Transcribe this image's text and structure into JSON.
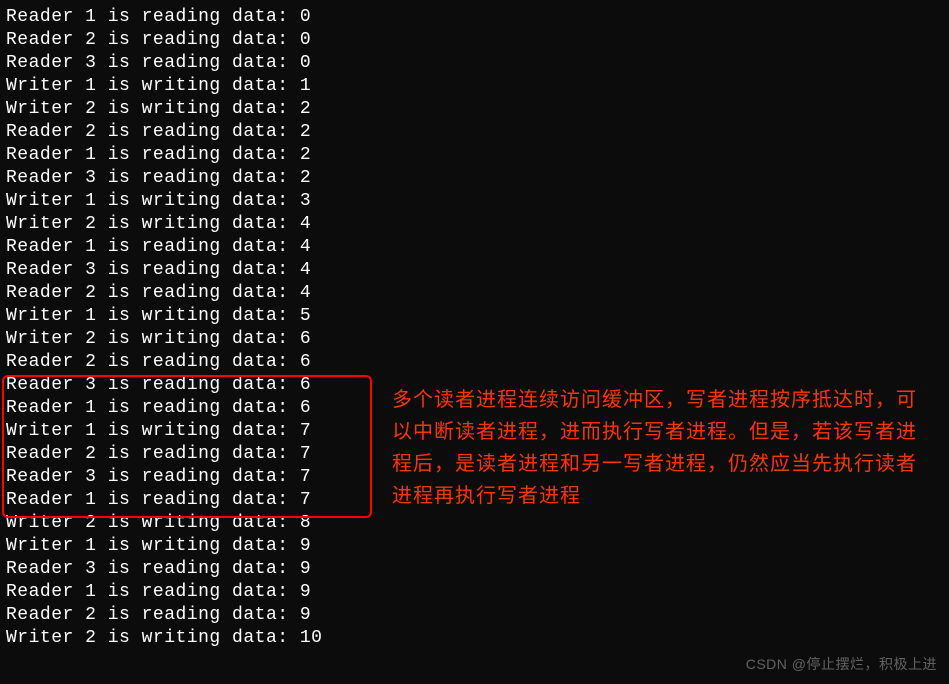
{
  "terminal": {
    "lines": [
      "Reader 1 is reading data: 0",
      "Reader 2 is reading data: 0",
      "Reader 3 is reading data: 0",
      "Writer 1 is writing data: 1",
      "Writer 2 is writing data: 2",
      "Reader 2 is reading data: 2",
      "Reader 1 is reading data: 2",
      "Reader 3 is reading data: 2",
      "Writer 1 is writing data: 3",
      "Writer 2 is writing data: 4",
      "Reader 1 is reading data: 4",
      "Reader 3 is reading data: 4",
      "Reader 2 is reading data: 4",
      "Writer 1 is writing data: 5",
      "Writer 2 is writing data: 6",
      "Reader 2 is reading data: 6",
      "Reader 3 is reading data: 6",
      "Reader 1 is reading data: 6",
      "Writer 1 is writing data: 7",
      "Reader 2 is reading data: 7",
      "Reader 3 is reading data: 7",
      "Reader 1 is reading data: 7",
      "Writer 2 is writing data: 8",
      "Writer 1 is writing data: 9",
      "Reader 3 is reading data: 9",
      "Reader 1 is reading data: 9",
      "Reader 2 is reading data: 9",
      "Writer 2 is writing data: 10"
    ]
  },
  "annotation": {
    "text": "多个读者进程连续访问缓冲区，写者进程按序抵达时，可以中断读者进程，进而执行写者进程。但是，若该写者进程后，是读者进程和另一写者进程，仍然应当先执行读者进程再执行写者进程"
  },
  "watermark": {
    "text": "CSDN @停止摆烂，积极上进"
  }
}
